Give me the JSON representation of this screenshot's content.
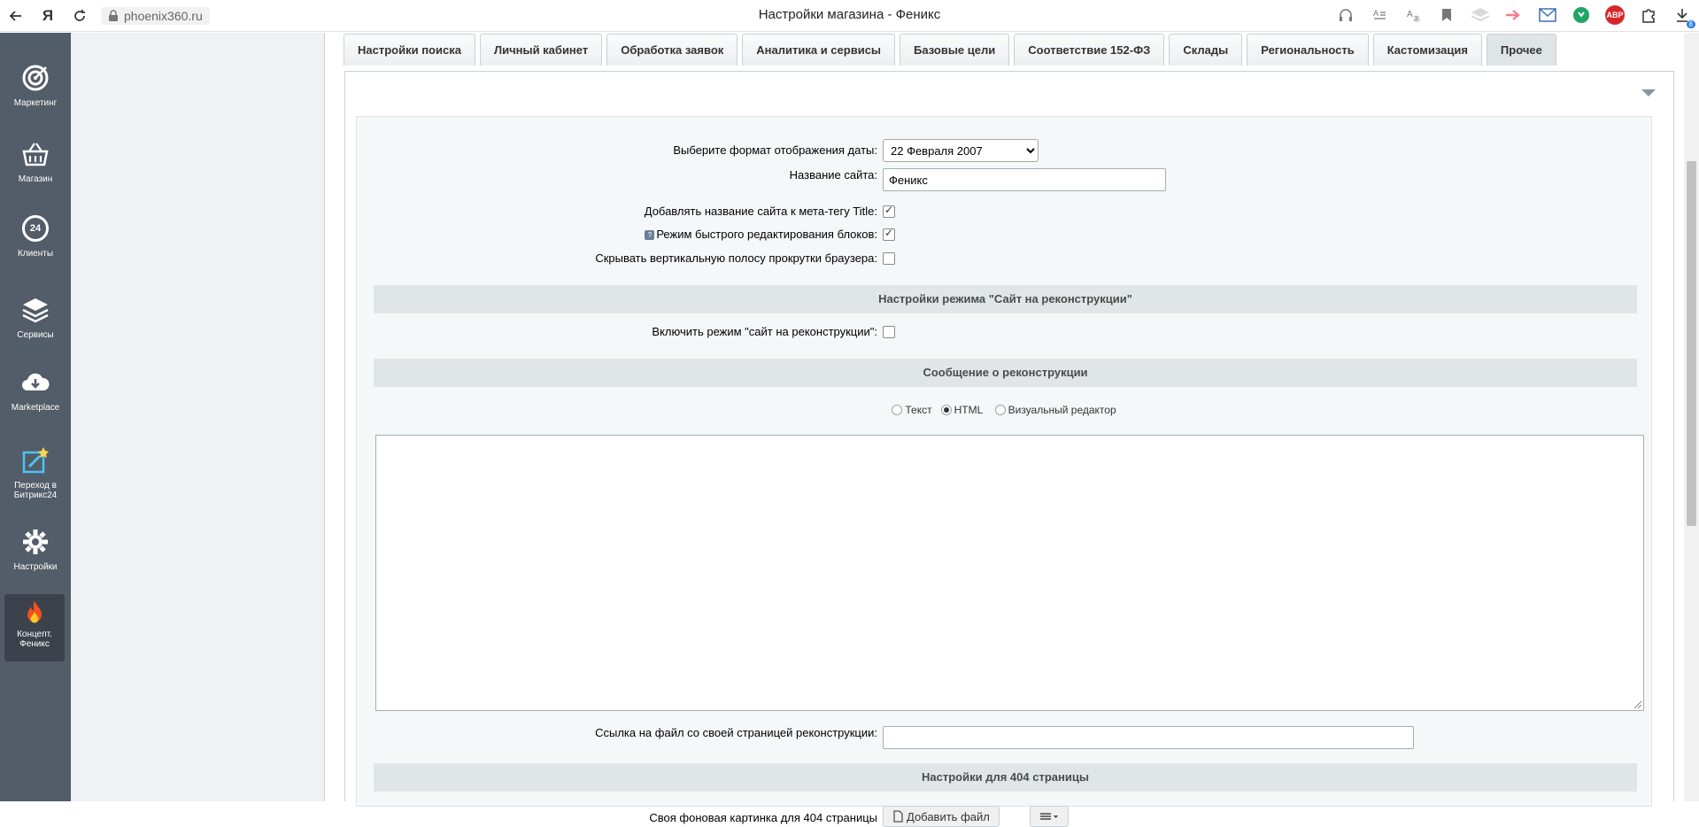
{
  "browser": {
    "url": "phoenix360.ru",
    "title": "Настройки магазина - Феникс",
    "download_badge": "8",
    "abp_label": "ABP"
  },
  "sidebar": {
    "items": [
      {
        "label": "Маркетинг"
      },
      {
        "label": "Магазин"
      },
      {
        "label": "Клиенты",
        "badge": "24"
      },
      {
        "label": "Сервисы"
      },
      {
        "label": "Marketplace"
      },
      {
        "label": "Переход в Битрикс24"
      },
      {
        "label": "Настройки"
      },
      {
        "label": "Концепт. Феникс"
      }
    ]
  },
  "tabs": [
    {
      "label": "Настройки поиска"
    },
    {
      "label": "Личный кабинет"
    },
    {
      "label": "Обработка заявок"
    },
    {
      "label": "Аналитика и сервисы"
    },
    {
      "label": "Базовые цели"
    },
    {
      "label": "Соответствие 152-ФЗ"
    },
    {
      "label": "Склады"
    },
    {
      "label": "Региональность"
    },
    {
      "label": "Кастомизация"
    },
    {
      "label": "Прочее"
    }
  ],
  "form": {
    "date_format_label": "Выберите формат отображения даты:",
    "date_format_value": "22 Февраля 2007",
    "site_name_label": "Название сайта:",
    "site_name_value": "Феникс",
    "add_title_label": "Добавлять название сайта к мета-тегу Title:",
    "quick_edit_label": "Режим быстрого редактирования блоков:",
    "hide_scroll_label": "Скрывать вертикальную полосу прокрутки браузера:",
    "section_reconstruction": "Настройки режима \"Сайт на реконструкции\"",
    "enable_reconstruction_label": "Включить режим \"сайт на реконструкции\":",
    "section_message": "Сообщение о реконструкции",
    "radio_text": "Текст",
    "radio_html": "HTML",
    "radio_visual": "Визуальный редактор",
    "file_link_label": "Ссылка на файл со своей страницей реконструкции:",
    "section_404": "Настройки для 404 страницы",
    "bg_image_label": "Своя фоновая картинка для 404 страницы",
    "add_file_button": "Добавить файл",
    "help_mark": "?"
  }
}
